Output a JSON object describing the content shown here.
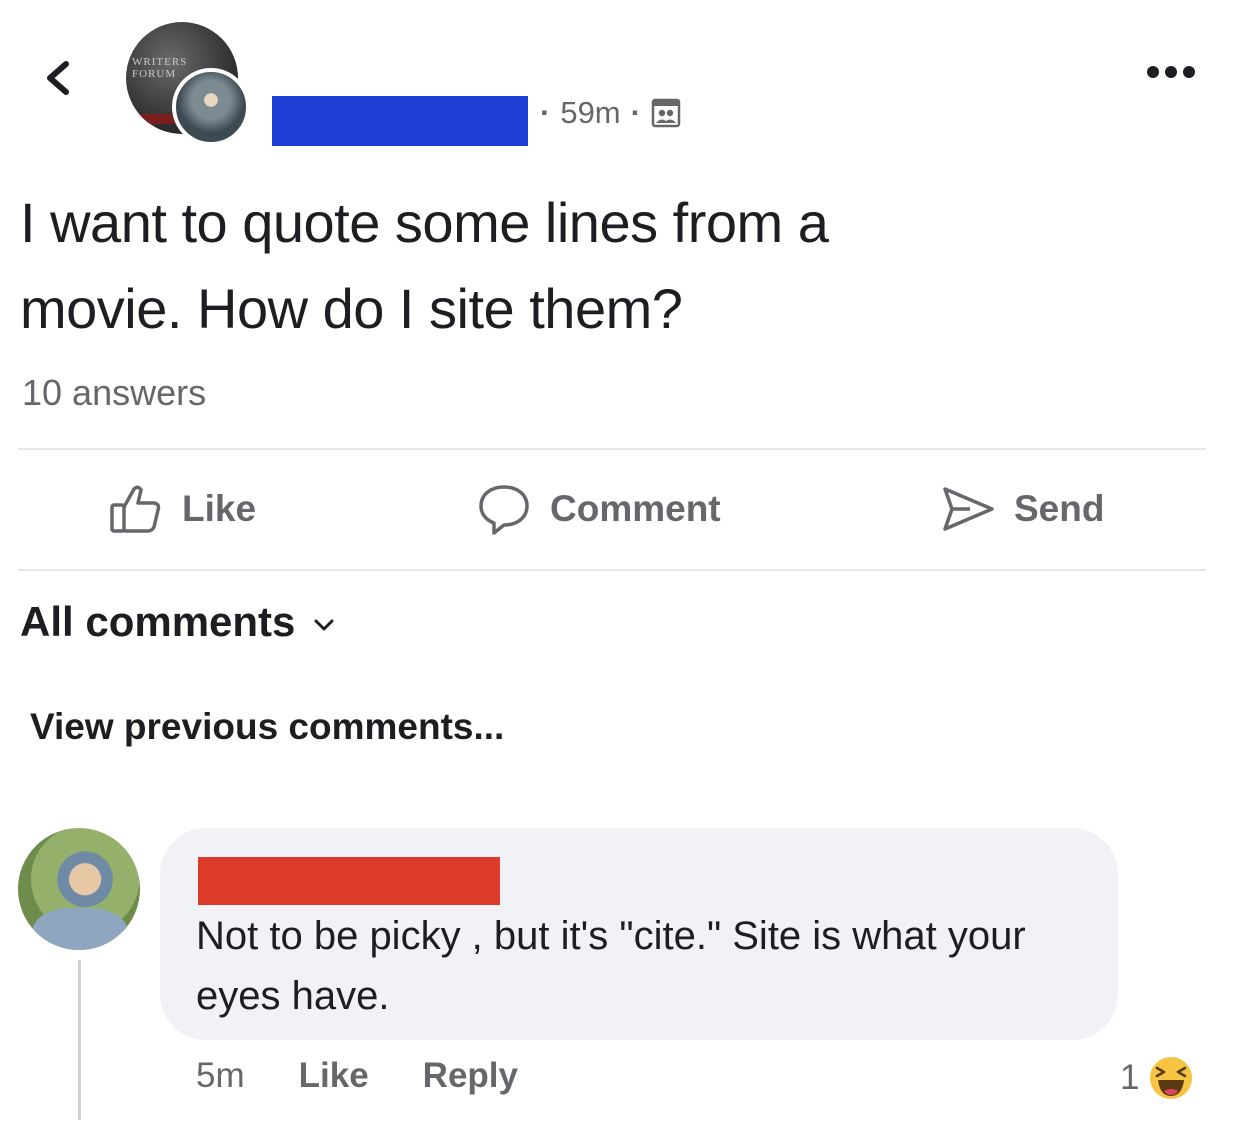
{
  "post": {
    "time": "59m",
    "separator": "·",
    "text_line1": "I want to quote some lines from a",
    "text_line2": "movie. How do I site them?",
    "answers": "10 answers"
  },
  "group_avatar_text": "WRITERS FORUM",
  "actions": {
    "like": "Like",
    "comment": "Comment",
    "send": "Send"
  },
  "comments_filter": "All comments",
  "view_previous": "View previous comments...",
  "comment": {
    "text": "Not to be picky , but it's \"cite.\" Site is what your eyes have.",
    "time": "5m",
    "like": "Like",
    "reply": "Reply",
    "reaction_count": "1",
    "reaction_icon": "haha-icon"
  },
  "colors": {
    "name_redaction": "#1e3fd6",
    "commenter_redaction": "#dc3a2b",
    "secondary_text": "#65676b",
    "bubble_bg": "#f0f2f5"
  }
}
